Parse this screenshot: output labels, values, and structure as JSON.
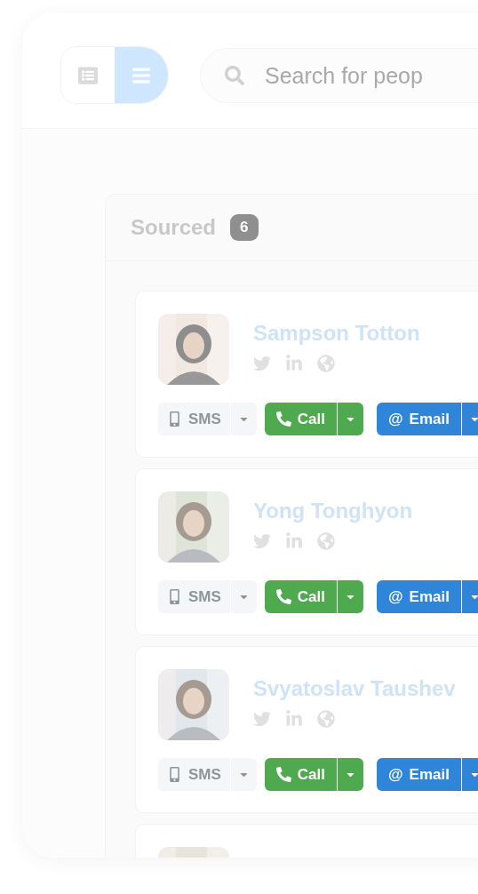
{
  "view_toggle": [
    {
      "kind": "table",
      "selected": false
    },
    {
      "kind": "list",
      "selected": true
    }
  ],
  "search": {
    "placeholder": "Search for peop"
  },
  "column": {
    "title": "Sourced",
    "count": "6"
  },
  "people": [
    {
      "kind": "full",
      "name": "Sampson Totton",
      "avatar": {
        "kind": "picture"
      },
      "actions": [
        {
          "kind": "sms",
          "label": "SMS"
        },
        {
          "kind": "call",
          "label": "Call"
        },
        {
          "kind": "email",
          "symbol": "@",
          "label": "Email"
        }
      ]
    },
    {
      "kind": "full",
      "name": "Yong Tonghyon",
      "avatar": {
        "kind": "picture"
      },
      "actions": [
        {
          "kind": "sms",
          "label": "SMS"
        },
        {
          "kind": "call",
          "label": "Call"
        },
        {
          "kind": "email",
          "symbol": "@",
          "label": "Email"
        }
      ]
    },
    {
      "kind": "full",
      "name": "Svyatoslav Taushev",
      "avatar": {
        "kind": "picture"
      },
      "actions": [
        {
          "kind": "sms",
          "label": "SMS"
        },
        {
          "kind": "call",
          "label": "Call"
        },
        {
          "kind": "email",
          "symbol": "@",
          "label": "Email"
        }
      ]
    },
    {
      "kind": "clipped",
      "avatar": {
        "kind": "picture"
      }
    }
  ]
}
